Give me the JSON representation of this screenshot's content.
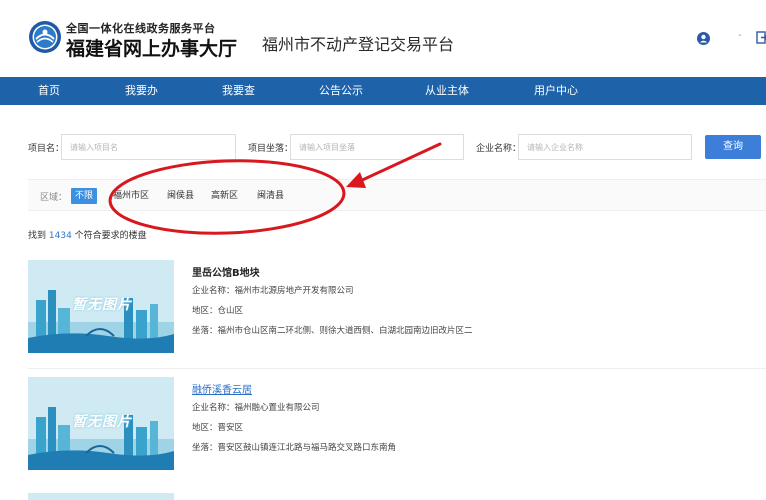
{
  "header": {
    "portal_top": "全国一体化在线政务服务平台",
    "portal_main": "福建省网上办事大厅",
    "platform_title": "福州市不动产登记交易平台",
    "separator": "-"
  },
  "nav": {
    "items": [
      {
        "label": "首页"
      },
      {
        "label": "我要办"
      },
      {
        "label": "我要查"
      },
      {
        "label": "公告公示"
      },
      {
        "label": "从业主体"
      },
      {
        "label": "用户中心"
      }
    ]
  },
  "search": {
    "project_label": "项目名：",
    "project_placeholder": "请输入项目名",
    "location_label": "项目坐落：",
    "location_placeholder": "请输入项目坐落",
    "company_label": "企业名称：",
    "company_placeholder": "请输入企业名称",
    "query_button": "查询"
  },
  "region": {
    "label": "区域：",
    "items": [
      {
        "label": "不限",
        "active": true
      },
      {
        "label": "福州市区",
        "active": false
      },
      {
        "label": "闽侯县",
        "active": false
      },
      {
        "label": "高新区",
        "active": false
      },
      {
        "label": "闽清县",
        "active": false
      }
    ]
  },
  "results": {
    "prefix": "找到",
    "count": "1434",
    "suffix": "个符合要求的楼盘"
  },
  "listings": [
    {
      "title": "里岳公馆B地块",
      "thumb_text": "暂无图片",
      "company": "企业名称：福州市北源房地产开发有限公司",
      "district": "地区：仓山区",
      "address": "坐落：福州市仓山区南二环北侧、则徐大道西侧、白湖北园南边旧改片区二"
    },
    {
      "title": "融侨溪香云居",
      "thumb_text": "暂无图片",
      "company": "企业名称：福州融心置业有限公司",
      "district": "地区：晋安区",
      "address": "坐落：晋安区鼓山镇连江北路与福马路交叉路口东南角"
    }
  ],
  "colors": {
    "nav_bg": "#1e62aa",
    "accent": "#3d7fd8",
    "annotation": "#d9171e",
    "link": "#2a6ec8"
  }
}
